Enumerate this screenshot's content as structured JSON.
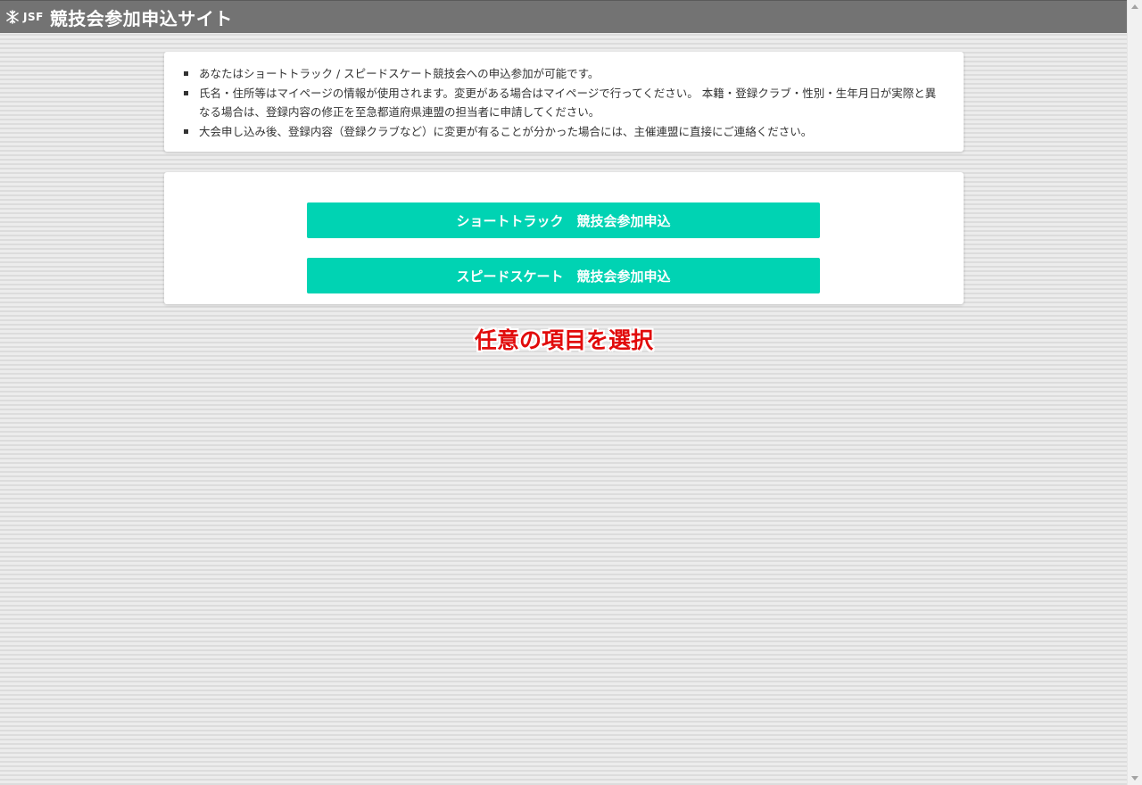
{
  "header": {
    "logo_text": "JSF",
    "title": "競技会参加申込サイト",
    "logo_icon": "snowflake-icon",
    "background_color": "#737373"
  },
  "info": {
    "items": [
      "あなたはショートトラック / スピードスケート競技会への申込参加が可能です。",
      "氏名・住所等はマイページの情報が使用されます。変更がある場合はマイページで行ってください。 本籍・登録クラブ・性別・生年月日が実際と異なる場合は、登録内容の修正を至急都道府県連盟の担当者に申請してください。",
      "大会申し込み後、登録内容（登録クラブなど）に変更が有ることが分かった場合には、主催連盟に直接にご連絡ください。"
    ]
  },
  "buttons": {
    "short_track": "ショートトラック　競技会参加申込",
    "speed_skate": "スピードスケート　競技会参加申込",
    "color": "#00d3b3"
  },
  "annotation": {
    "text": "任意の項目を選択",
    "color": "#e10b0b"
  }
}
